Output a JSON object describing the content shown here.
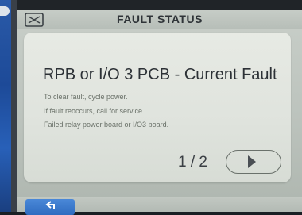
{
  "header": {
    "title": "FAULT STATUS",
    "icon": "system-logo-icon"
  },
  "fault": {
    "title": "RPB or I/O 3 PCB - Current Fault",
    "lines": [
      "To clear fault, cycle power.",
      "If fault reoccurs, call for service.",
      "Failed relay power board or I/O3 board."
    ]
  },
  "pager": {
    "indicator": "1 / 2",
    "next_icon": "play-arrow-icon"
  },
  "footer": {
    "back_icon": "back-arrow-icon"
  },
  "colors": {
    "accent": "#2f6cc0",
    "screen_bg": "#c9cfc9",
    "card_bg": "#e3e6e0"
  }
}
